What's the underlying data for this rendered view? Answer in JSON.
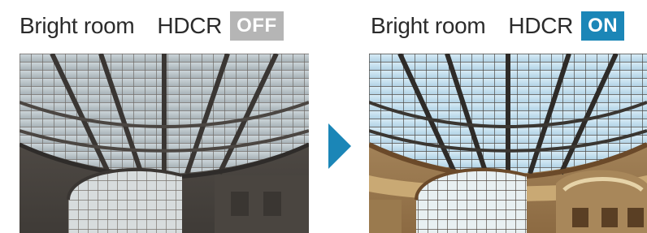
{
  "comparison": {
    "before": {
      "caption": "Bright room",
      "hdcr_label": "HDCR",
      "status": "OFF",
      "status_color": "#b5b5b5"
    },
    "after": {
      "caption": "Bright room",
      "hdcr_label": "HDCR",
      "status": "ON",
      "status_color": "#1b86b7"
    },
    "arrow_icon": "play-triangle-icon",
    "arrow_color": "#1b86b7"
  }
}
